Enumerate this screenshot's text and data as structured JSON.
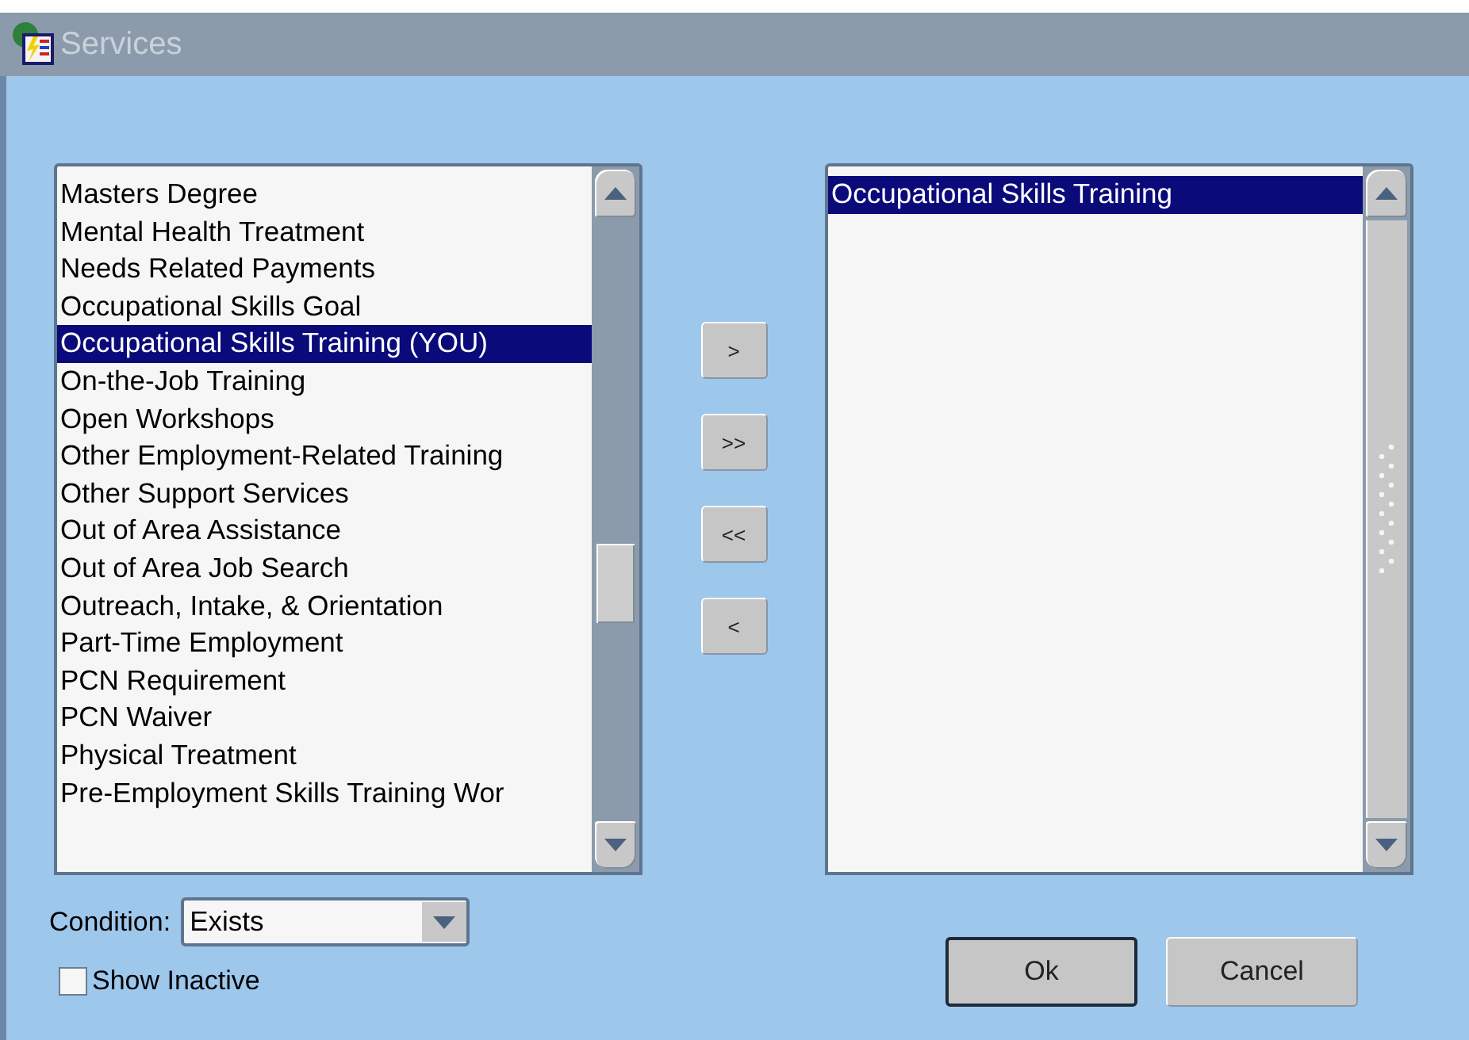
{
  "window": {
    "title": "Services"
  },
  "available_list": {
    "items": [
      {
        "label": "Masters Degree",
        "selected": false
      },
      {
        "label": "Mental Health Treatment",
        "selected": false
      },
      {
        "label": "Needs Related Payments",
        "selected": false
      },
      {
        "label": "Occupational Skills Goal",
        "selected": false
      },
      {
        "label": "Occupational Skills Training (YOU)",
        "selected": true
      },
      {
        "label": "On-the-Job Training",
        "selected": false
      },
      {
        "label": "Open Workshops",
        "selected": false
      },
      {
        "label": "Other Employment-Related Training",
        "selected": false
      },
      {
        "label": "Other Support Services",
        "selected": false
      },
      {
        "label": "Out of Area Assistance",
        "selected": false
      },
      {
        "label": "Out of Area Job Search",
        "selected": false
      },
      {
        "label": "Outreach, Intake, & Orientation",
        "selected": false
      },
      {
        "label": "Part-Time Employment",
        "selected": false
      },
      {
        "label": "PCN Requirement",
        "selected": false
      },
      {
        "label": "PCN Waiver",
        "selected": false
      },
      {
        "label": "Physical Treatment",
        "selected": false
      },
      {
        "label": "Pre-Employment Skills Training Wor",
        "selected": false
      }
    ]
  },
  "transfer_buttons": [
    ">",
    ">>",
    "<<",
    "<"
  ],
  "chosen_list": {
    "items": [
      {
        "label": "Occupational Skills Training",
        "selected": true
      }
    ]
  },
  "condition": {
    "label": "Condition:",
    "value": "Exists"
  },
  "show_inactive": {
    "label": "Show Inactive",
    "checked": false
  },
  "buttons": [
    {
      "label": "Ok",
      "default": true
    },
    {
      "label": "Cancel",
      "default": false
    }
  ]
}
